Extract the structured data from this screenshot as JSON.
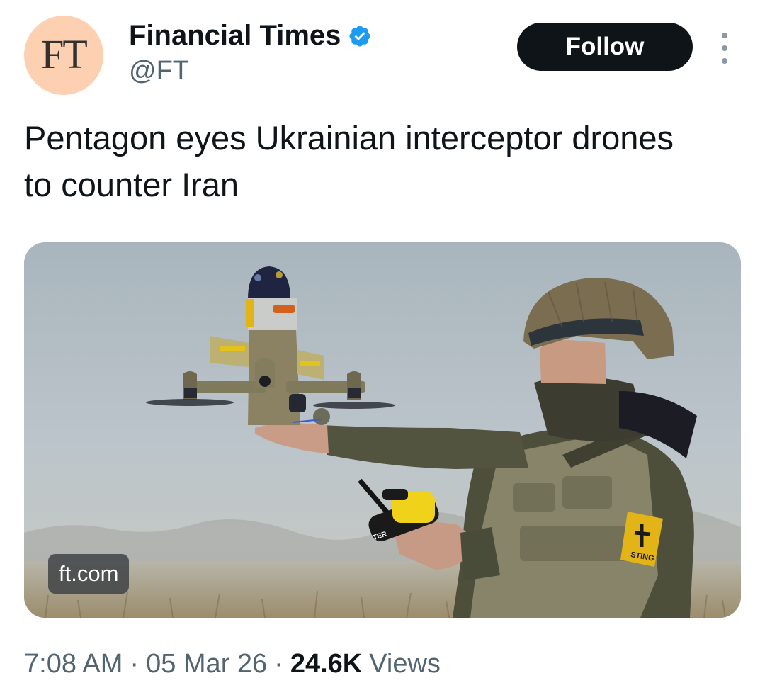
{
  "author": {
    "avatar_text": "FT",
    "display_name": "Financial Times",
    "handle": "@FT",
    "verified": true,
    "avatar_bg_color": "#fcd0b1",
    "badge_color": "#1d9bf0"
  },
  "actions": {
    "follow_label": "Follow",
    "more_icon": "more-vertical-icon"
  },
  "tweet": {
    "text": "Pentagon eyes Ukrainian interceptor drones to counter Iran"
  },
  "media": {
    "source_label": "ft.com",
    "patch_text": "STING",
    "controller_text": "TER"
  },
  "meta": {
    "time": "7:08 AM",
    "separator": "·",
    "date": "05 Mar 26",
    "views_count": "24.6K",
    "views_label": "Views"
  }
}
